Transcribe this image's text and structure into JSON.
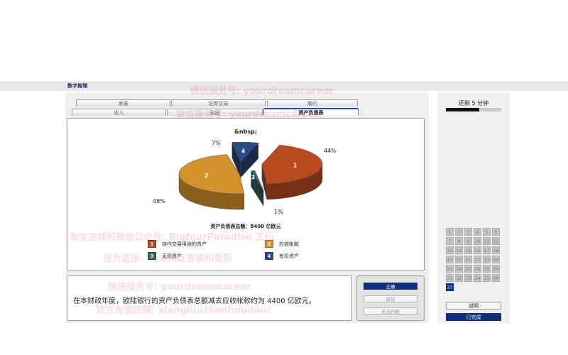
{
  "app": {
    "title": "数字推理"
  },
  "tabs_top": [
    "发展",
    "证券交易",
    "履约"
  ],
  "tabs_bottom": [
    "收入",
    "支出",
    "资产负债表"
  ],
  "active_tab": "资产负债表",
  "timer": {
    "label": "还剩 5 分钟",
    "progress": 0.6
  },
  "chart_data": {
    "type": "pie",
    "title": "&nbsp;",
    "total_label": "资产负债表总额：8400 亿欧元",
    "slices": [
      {
        "index": "1",
        "label": "持作交易用途的资产",
        "percent": 44,
        "display": "44%",
        "color": "#b84a1f"
      },
      {
        "index": "2",
        "label": "应收帐款",
        "percent": 48,
        "display": "48%",
        "color": "#d4922d"
      },
      {
        "index": "3",
        "label": "无形资产",
        "percent": 1,
        "display": "1%",
        "color": "#2f6a63"
      },
      {
        "index": "4",
        "label": "有形资产",
        "percent": 7,
        "display": "7%",
        "color": "#2d4a86"
      }
    ]
  },
  "statement": "在本财政年度，欧陆银行的资产负债表总额减去应收帐款约为 4400 亿欧元。",
  "answers": {
    "true_label": "正确",
    "false_label": "错误",
    "cannot_say_label": "无法判断",
    "selected": "true"
  },
  "question_grid": {
    "numbers": [
      "1",
      "2",
      "3",
      "4",
      "5",
      "6",
      "7",
      "8",
      "9",
      "10",
      "11",
      "12",
      "13",
      "14",
      "15",
      "16",
      "17",
      "18",
      "19",
      "20",
      "21",
      "22",
      "23",
      "24",
      "25",
      "26",
      "27",
      "28",
      "29",
      "30",
      "31",
      "32",
      "33",
      "34",
      "35",
      "36",
      "37"
    ],
    "current": "37"
  },
  "side_buttons": {
    "help_label": "说明",
    "finish_label": "已完成"
  },
  "watermarks": [
    "微信服务号: yourdreamcareer",
    "微信服务号: yourdreamcareer",
    "淘宝店铺和微信公众号: BigfourParadise 五仙",
    "皆为盗版，无法保证答案和更新",
    "微信服务号: yourdreamcareer",
    "官方淘宝店铺: xianghuizhanhoudour"
  ]
}
